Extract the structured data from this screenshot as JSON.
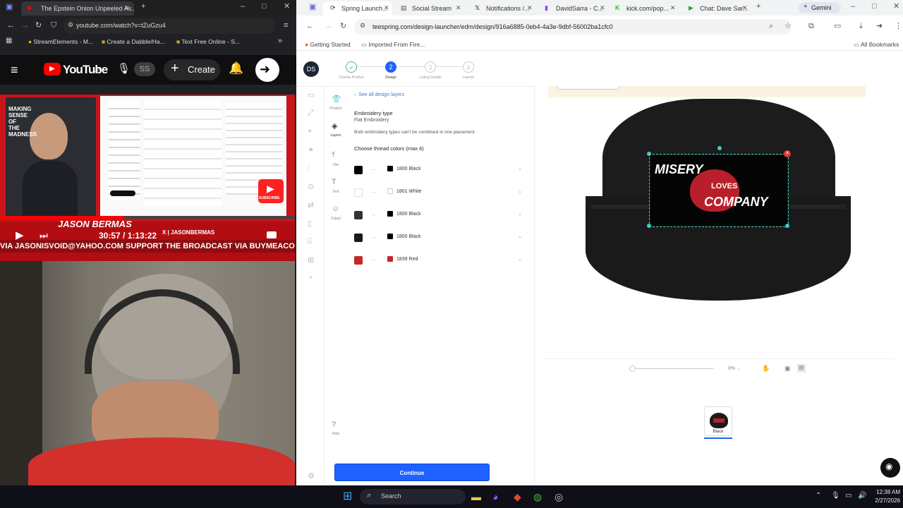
{
  "left_browser": {
    "tabs": [
      {
        "title": "The Epstein Onion Unpeeled As..."
      }
    ],
    "url": "youtube.com/watch?v=tZuGzu4",
    "bookmarks": [
      "StreamElements - M...",
      "Create a Dabble/Ha...",
      "Text Free Online - S..."
    ],
    "youtube": {
      "logo_text": "YouTube",
      "avatar_text": "SS",
      "create_label": "Create",
      "video_banner": "JASON BERMAS",
      "video_sub": "X | JASONBERMAS",
      "ticker": "VIA JASONISVOID@YAHOO.COM  SUPPORT THE BROADCAST VIA BUYMEACOFFEE.COM",
      "time": "30:57 / 1:13:22",
      "logo_left": "MAKING SENSE OF THE MADNESS",
      "subscribe": "SUBSCRIBE"
    }
  },
  "right_browser": {
    "tabs": [
      {
        "title": "Spring Launch..."
      },
      {
        "title": "Social Stream"
      },
      {
        "title": "Notifications /..."
      },
      {
        "title": "DavidSarra - C..."
      },
      {
        "title": "kick.com/pop..."
      },
      {
        "title": "Chat: Dave Sar..."
      }
    ],
    "gemini_label": "Gemini",
    "url": "teespring.com/design-launcher/edm/design/916a6885-0eb4-4a3e-9dbf-56002ba1cfc0",
    "bookmarks": [
      "Getting Started",
      "Imported From Fire..."
    ],
    "all_bookmarks": "All Bookmarks",
    "app": {
      "avatar": "DS",
      "steps": [
        {
          "num": "",
          "label": "Choose Product",
          "state": "done"
        },
        {
          "num": "2",
          "label": "Design",
          "state": "active"
        },
        {
          "num": "3",
          "label": "Listing Details",
          "state": "todo"
        },
        {
          "num": "4",
          "label": "Launch",
          "state": "todo"
        }
      ],
      "sidebar": [
        {
          "label": "Product"
        },
        {
          "label": "Layers"
        },
        {
          "label": "File"
        },
        {
          "label": "Text"
        },
        {
          "label": "Clipart"
        },
        {
          "label": "Help"
        }
      ],
      "back_link": "See all design layers",
      "embroidery_type_label": "Embroidery type",
      "embroidery_type_value": "Flat Embroidery",
      "embroidery_note": "Both embroidery types can't be combined in one placement",
      "thread_heading": "Choose thread colors (max 6)",
      "threads": [
        {
          "name": "1800 Black",
          "color": "#000000"
        },
        {
          "name": "1801 White",
          "color": "#ffffff"
        },
        {
          "name": "1800 Black",
          "color": "#333333"
        },
        {
          "name": "1800 Black",
          "color": "#1a1a1a"
        },
        {
          "name": "1839 Red",
          "color": "#c8242b"
        }
      ],
      "design_text": [
        "MISERY",
        "LOVES",
        "COMPANY"
      ],
      "zoom": "0%",
      "color_variant": "Black",
      "continue_label": "Continue"
    }
  },
  "taskbar": {
    "search_label": "Search",
    "time": "12:38 AM",
    "date": "2/27/2026"
  }
}
